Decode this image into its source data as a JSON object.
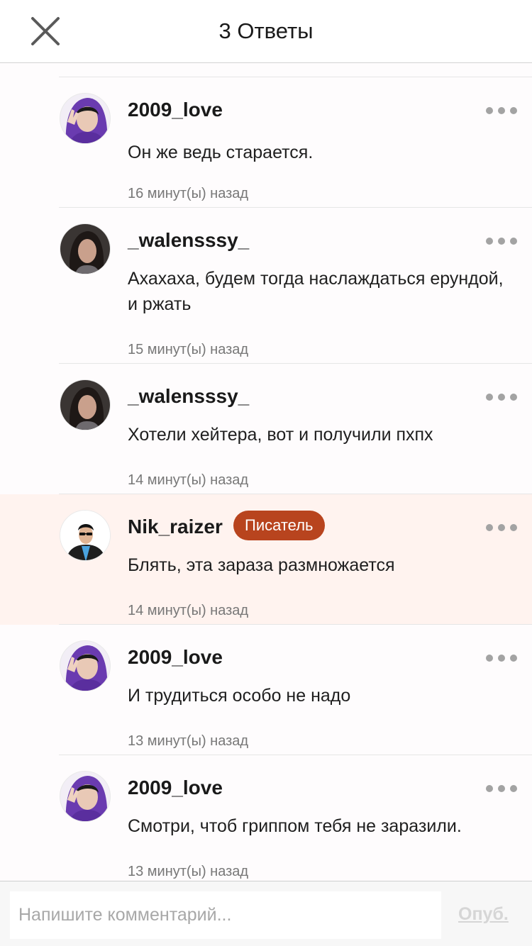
{
  "header": {
    "title": "3 Ответы"
  },
  "comments": [
    {
      "username": "2009_love",
      "avatar": "purple-hood",
      "text": "Он же ведь старается.",
      "time": "16 минут(ы) назад",
      "badge": ""
    },
    {
      "username": "_walensssy_",
      "avatar": "dark-hair",
      "text": "Ахахаха, будем тогда наслаждаться ерундой, и ржать",
      "time": "15 минут(ы) назад",
      "badge": ""
    },
    {
      "username": "_walensssy_",
      "avatar": "dark-hair",
      "text": "Хотели хейтера, вот и получили пхпх",
      "time": "14 минут(ы) назад",
      "badge": ""
    },
    {
      "username": "Nik_raizer",
      "avatar": "sunglasses-man",
      "text": "Блять, эта зараза размножается",
      "time": "14 минут(ы) назад",
      "badge": "Писатель"
    },
    {
      "username": "2009_love",
      "avatar": "purple-hood",
      "text": "И трудиться особо не надо",
      "time": "13 минут(ы) назад",
      "badge": ""
    },
    {
      "username": "2009_love",
      "avatar": "purple-hood",
      "text": "Смотри, чтоб гриппом тебя не заразили.",
      "time": "13 минут(ы) назад",
      "badge": ""
    }
  ],
  "footer": {
    "placeholder": "Напишите комментарий...",
    "publish_label": "Опуб."
  },
  "colors": {
    "badge": "#b8441e",
    "highlight": "#fff3ef",
    "publish_disabled": "#d6d6d6"
  }
}
